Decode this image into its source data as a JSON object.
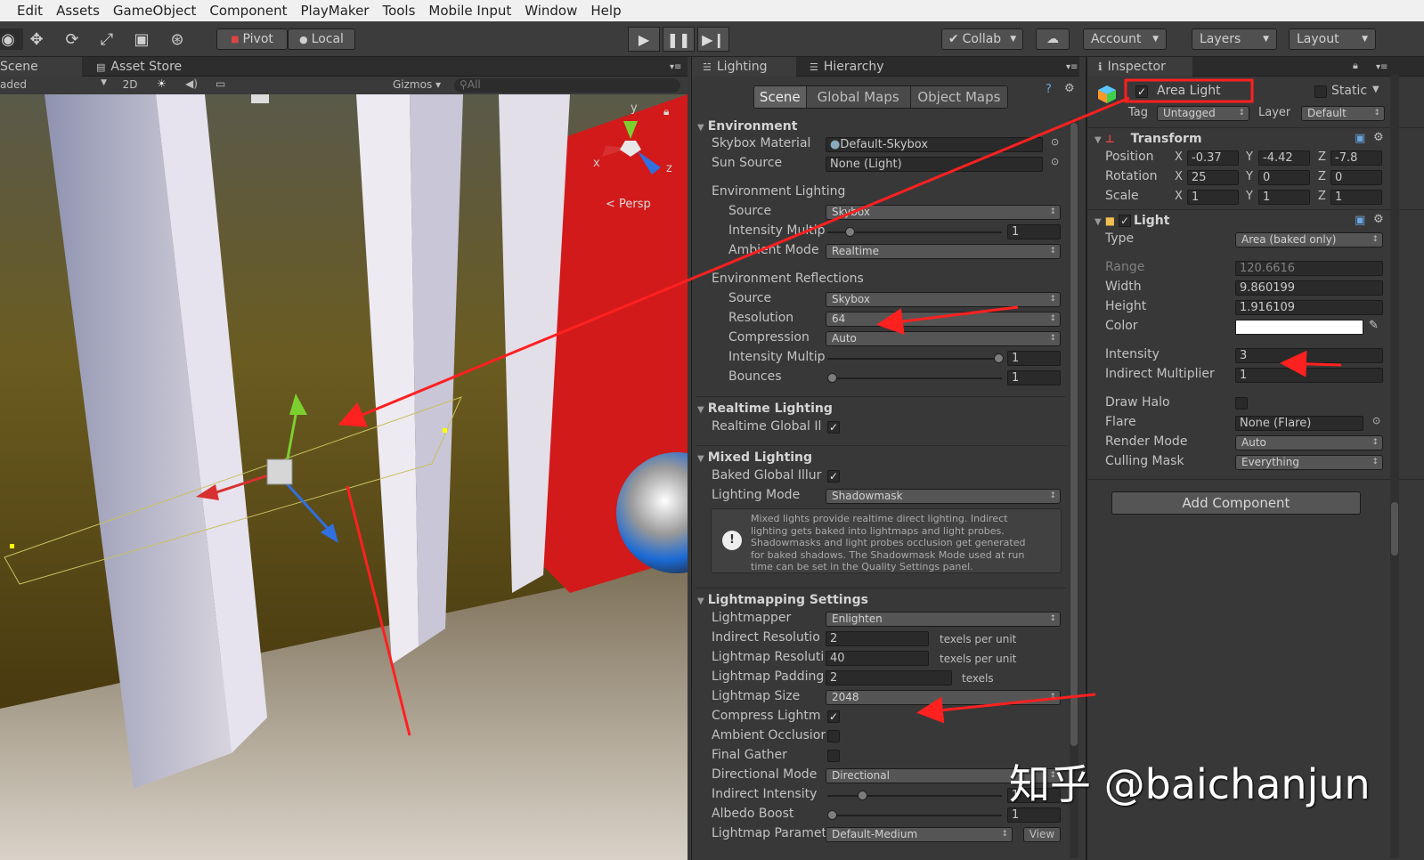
{
  "menu": [
    "Edit",
    "Assets",
    "GameObject",
    "Component",
    "PlayMaker",
    "Tools",
    "Mobile Input",
    "Window",
    "Help"
  ],
  "toolbar": {
    "pivot": "Pivot",
    "local": "Local",
    "collab": "Collab",
    "account": "Account",
    "layers": "Layers",
    "layout": "Layout"
  },
  "scene": {
    "tab": "Scene",
    "asset_store": "Asset Store",
    "shaded": "aded",
    "mode2d": "2D",
    "gizmos": "Gizmos",
    "search": "All",
    "persp": "Persp",
    "axis_x": "x",
    "axis_y": "y",
    "axis_z": "z"
  },
  "lighting": {
    "tab": "Lighting",
    "hierarchy": "Hierarchy",
    "subtabs": [
      "Scene",
      "Global Maps",
      "Object Maps"
    ],
    "env": {
      "title": "Environment",
      "skybox_label": "Skybox Material",
      "skybox": "Default-Skybox",
      "sun_label": "Sun Source",
      "sun": "None (Light)",
      "env_lighting": "Environment Lighting",
      "source_label": "Source",
      "source": "Skybox",
      "intensity_label": "Intensity Multip",
      "intensity": "1",
      "ambient_label": "Ambient Mode",
      "ambient": "Realtime",
      "env_refl": "Environment Reflections",
      "refl_source_label": "Source",
      "refl_source": "Skybox",
      "resolution_label": "Resolution",
      "resolution": "64",
      "compression_label": "Compression",
      "compression": "Auto",
      "refl_int_label": "Intensity Multip",
      "refl_int": "1",
      "bounces_label": "Bounces",
      "bounces": "1"
    },
    "realtime": {
      "title": "Realtime Lighting",
      "gi_label": "Realtime Global Il"
    },
    "mixed": {
      "title": "Mixed Lighting",
      "baked_label": "Baked Global Illur",
      "mode_label": "Lighting Mode",
      "mode": "Shadowmask",
      "help": [
        "Mixed lights provide realtime direct lighting. Indirect",
        "lighting gets baked into lightmaps and light probes.",
        "Shadowmasks and light probes occlusion get generated",
        "for baked shadows. The Shadowmask Mode used at run",
        "time can be set in the Quality Settings panel."
      ]
    },
    "lm": {
      "title": "Lightmapping Settings",
      "lightmapper_label": "Lightmapper",
      "lightmapper": "Enlighten",
      "ind_res_label": "Indirect Resolutio",
      "ind_res": "2",
      "ind_res_unit": "texels per unit",
      "lm_res_label": "Lightmap Resoluti",
      "lm_res": "40",
      "lm_res_unit": "texels per unit",
      "padding_label": "Lightmap Padding",
      "padding": "2",
      "padding_unit": "texels",
      "size_label": "Lightmap Size",
      "size": "2048",
      "compress_label": "Compress Lightm",
      "ao_label": "Ambient Occlusior",
      "fg_label": "Final Gather",
      "dir_label": "Directional Mode",
      "dir": "Directional",
      "ind_int_label": "Indirect Intensity",
      "ind_int": "1",
      "albedo_label": "Albedo Boost",
      "albedo": "1",
      "params_label": "Lightmap Paramet",
      "params": "Default-Medium",
      "view": "View"
    }
  },
  "inspector": {
    "tab": "Inspector",
    "name": "Area Light",
    "static": "Static",
    "tag_label": "Tag",
    "tag": "Untagged",
    "layer_label": "Layer",
    "layer": "Default",
    "transform": {
      "title": "Transform",
      "pos_label": "Position",
      "rot_label": "Rotation",
      "scale_label": "Scale",
      "x": "X",
      "y": "Y",
      "z": "Z",
      "pos": [
        "-0.37",
        "-4.42",
        "-7.8"
      ],
      "rot": [
        "25",
        "0",
        "0"
      ],
      "scale": [
        "1",
        "1",
        "1"
      ]
    },
    "light": {
      "title": "Light",
      "type_label": "Type",
      "type": "Area (baked only)",
      "range_label": "Range",
      "range": "120.6616",
      "width_label": "Width",
      "width": "9.860199",
      "height_label": "Height",
      "height": "1.916109",
      "color_label": "Color",
      "intensity_label": "Intensity",
      "intensity": "3",
      "indirect_label": "Indirect Multiplier",
      "indirect": "1",
      "halo_label": "Draw Halo",
      "flare_label": "Flare",
      "flare": "None (Flare)",
      "render_label": "Render Mode",
      "render": "Auto",
      "culling_label": "Culling Mask",
      "culling": "Everything"
    },
    "add_component": "Add Component"
  },
  "watermark": "知乎 @baichanjun",
  "colors": {
    "annotation": "#ff2020",
    "scene_red": "#d21a1a",
    "panel_bg": "#383838"
  }
}
